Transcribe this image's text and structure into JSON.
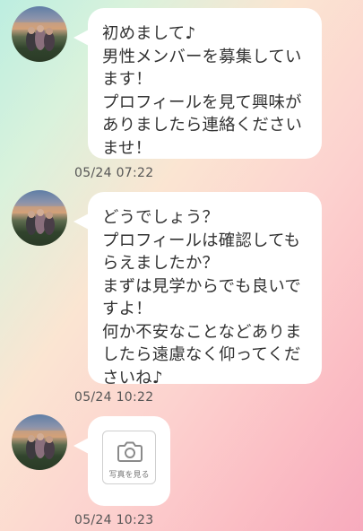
{
  "messages": [
    {
      "text": "初めまして♪\n男性メンバーを募集してい\nます！\nプロフィールを見て興味が\nありましたら連絡ください\nませ！",
      "timestamp": "05/24 07:22"
    },
    {
      "text": "どうでしょう？\nプロフィールは確認しても\nらえましたか？\nまずは見学からでも良いで\nすよ！\n何か不安なことなどありま\nしたら遠慮なく仰ってくだ\nさいね♪",
      "timestamp": "05/24 10:22"
    },
    {
      "photo_label": "写真を見る",
      "photo_icon": "camera-icon",
      "timestamp": "05/24 10:23"
    }
  ]
}
